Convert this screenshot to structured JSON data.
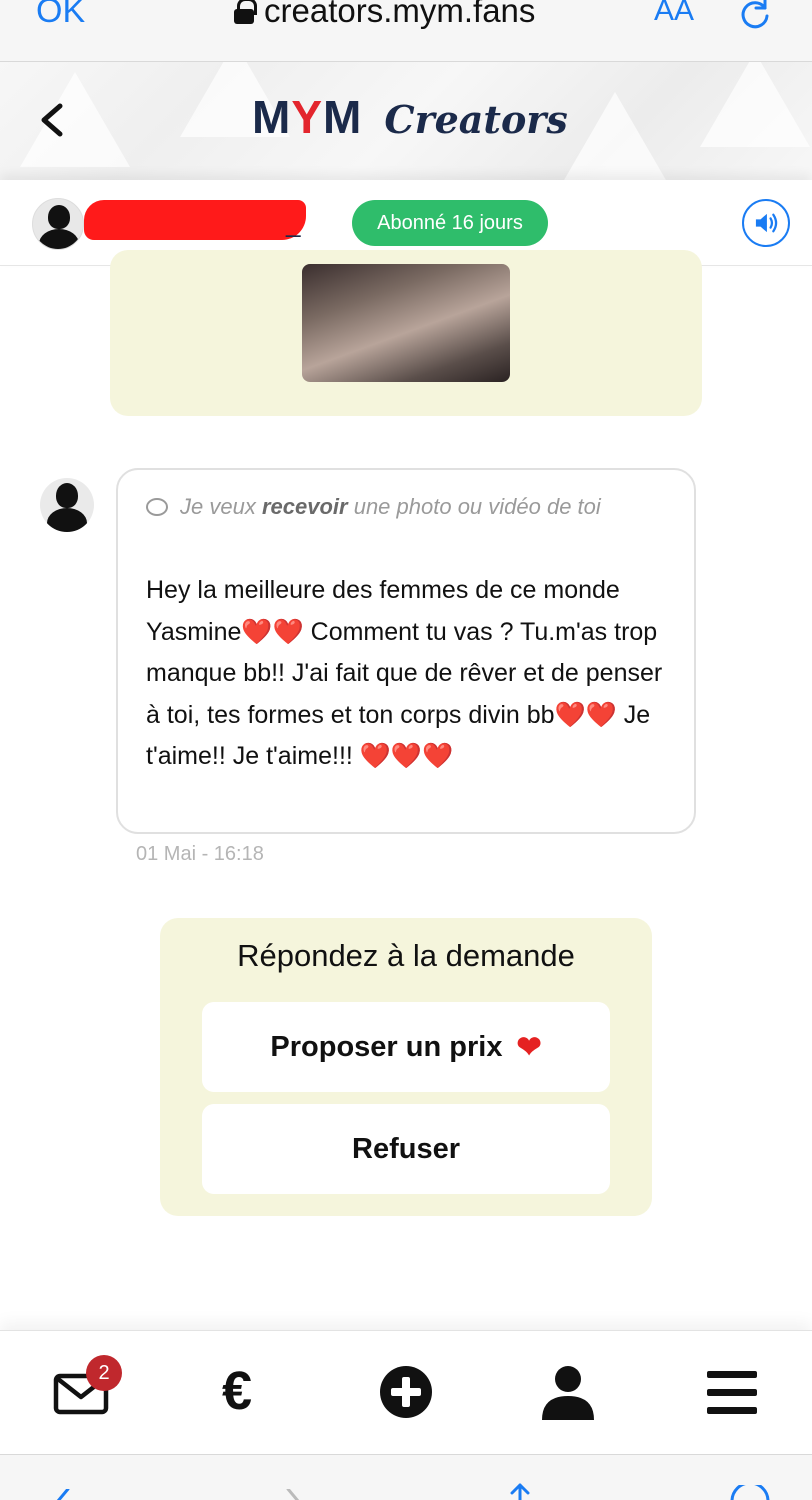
{
  "browser": {
    "done_label": "OK",
    "url": "creators.mym.fans",
    "text_size_label": "AA"
  },
  "header": {
    "logo_m1": "M",
    "logo_y": "Y",
    "logo_m2": "M",
    "logo_creators": "Creators"
  },
  "subscriber": {
    "name_tail": "_",
    "badge": "Abonné 16 jours"
  },
  "message": {
    "request_prefix": "Je veux",
    "request_bold": "recevoir",
    "request_suffix": "une photo ou vidéo de toi",
    "text_part1": "Hey la meilleure des femmes de ce monde Yasmine",
    "hearts1": "❤️❤️",
    "text_part2": " Comment tu vas ? Tu.m'as trop manque bb!! J'ai fait que de rêver et de penser à toi, tes formes et ton corps divin bb",
    "hearts2": "❤️❤️",
    "text_part3": " Je t'aime!! Je t'aime!!! ",
    "hearts3": "❤️❤️❤️",
    "timestamp": "01 Mai - 16:18"
  },
  "response": {
    "title": "Répondez à la demande",
    "propose_label": "Proposer un prix",
    "propose_heart": "❤",
    "refuse_label": "Refuser"
  },
  "bottom_nav": {
    "messages_badge": "2",
    "euro_symbol": "€",
    "items": [
      "mail-icon",
      "euro-icon",
      "plus-circle-icon",
      "user-icon",
      "menu-icon"
    ]
  },
  "colors": {
    "accent_blue": "#1a7cf3",
    "brand_navy": "#1b2a4a",
    "brand_red": "#e3252d",
    "badge_green": "#2fbd6b",
    "panel_cream": "#f5f5dc",
    "notification_red": "#c0282d"
  }
}
